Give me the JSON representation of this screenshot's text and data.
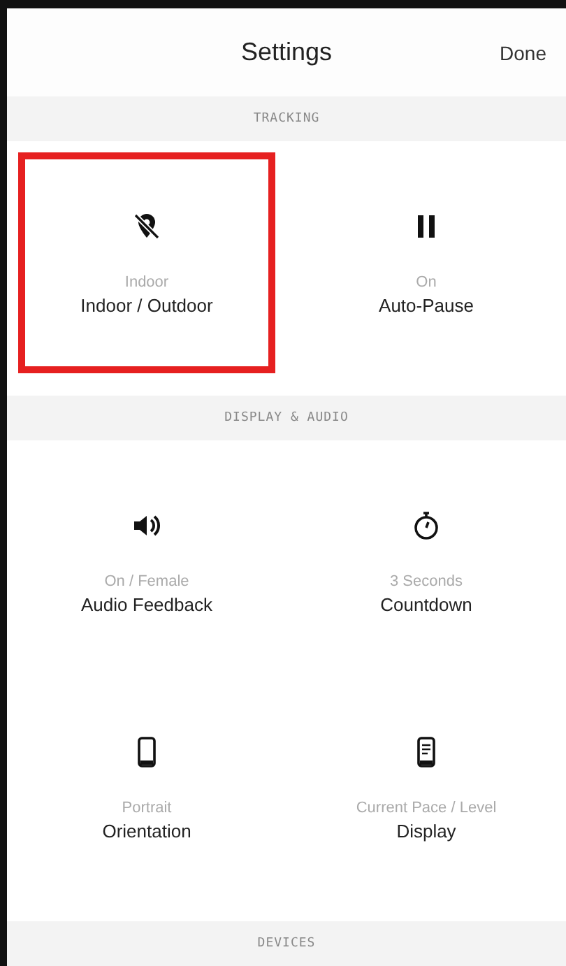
{
  "header": {
    "title": "Settings",
    "done": "Done"
  },
  "sections": [
    {
      "title": "TRACKING",
      "tiles": [
        {
          "kind": "location-off",
          "value": "Indoor",
          "label": "Indoor / Outdoor",
          "highlighted": true
        },
        {
          "kind": "pause",
          "value": "On",
          "label": "Auto-Pause",
          "highlighted": false
        }
      ]
    },
    {
      "title": "DISPLAY & AUDIO",
      "tiles": [
        {
          "kind": "speaker",
          "value": "On / Female",
          "label": "Audio Feedback",
          "highlighted": false
        },
        {
          "kind": "stopwatch",
          "value": "3 Seconds",
          "label": "Countdown",
          "highlighted": false
        },
        {
          "kind": "phone",
          "value": "Portrait",
          "label": "Orientation",
          "highlighted": false
        },
        {
          "kind": "display",
          "value": "Current Pace / Level",
          "label": "Display",
          "highlighted": false
        }
      ]
    },
    {
      "title": "DEVICES"
    }
  ]
}
